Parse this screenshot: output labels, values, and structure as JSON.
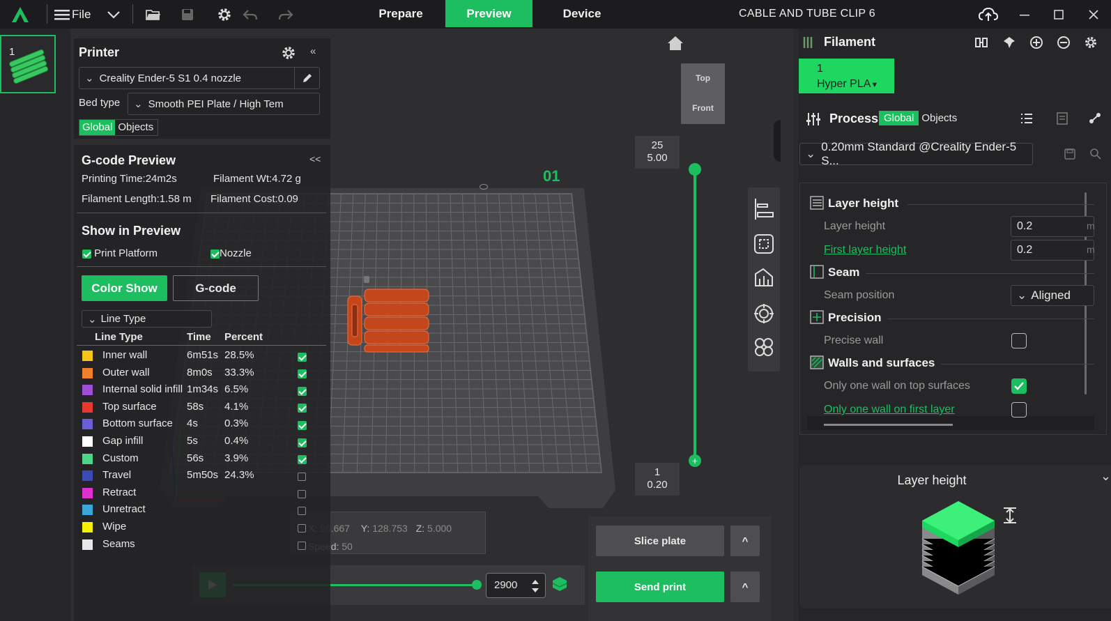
{
  "topbar": {
    "file_label": "File",
    "tabs": [
      "Prepare",
      "Preview",
      "Device"
    ],
    "project_title": "CABLE AND TUBE CLIP 6"
  },
  "plate_thumb": {
    "index": "1"
  },
  "printer": {
    "title": "Printer",
    "printer_name": "Creality Ender-5 S1 0.4 nozzle",
    "bed_type_label": "Bed type",
    "bed_type_value": "Smooth PEI Plate / High Tem",
    "scope_global": "Global",
    "scope_objects": "Objects"
  },
  "gcode": {
    "title": "G-code Preview",
    "collapse": "<<",
    "printing_time": "Printing Time:24m2s",
    "filament_wt": "Filament Wt:4.72 g",
    "filament_length": "Filament Length:1.58 m",
    "filament_cost": "Filament Cost:0.09",
    "show_title": "Show in Preview",
    "print_platform": "Print Platform",
    "nozzle": "Nozzle",
    "color_show_btn": "Color Show",
    "gcode_btn": "G-code",
    "view_select": "Line Type",
    "headers": {
      "type": "Line Type",
      "time": "Time",
      "percent": "Percent"
    },
    "rows": [
      {
        "name": "Inner wall",
        "time": "6m51s",
        "percent": "28.5%",
        "color": "#f5c518",
        "checked": true
      },
      {
        "name": "Outer wall",
        "time": "8m0s",
        "percent": "33.3%",
        "color": "#f07f2e",
        "checked": true
      },
      {
        "name": "Internal solid infill",
        "time": "1m34s",
        "percent": "6.5%",
        "color": "#a04ed6",
        "checked": true
      },
      {
        "name": "Top surface",
        "time": "58s",
        "percent": "4.1%",
        "color": "#e8392d",
        "checked": true
      },
      {
        "name": "Bottom surface",
        "time": "4s",
        "percent": "0.3%",
        "color": "#6b5fd8",
        "checked": true
      },
      {
        "name": "Gap infill",
        "time": "5s",
        "percent": "0.4%",
        "color": "#ffffff",
        "checked": true
      },
      {
        "name": "Custom",
        "time": "56s",
        "percent": "3.9%",
        "color": "#4fd58a",
        "checked": true
      },
      {
        "name": "Travel",
        "time": "5m50s",
        "percent": "24.3%",
        "color": "#3a4bb5",
        "checked": false
      },
      {
        "name": "Retract",
        "time": "",
        "percent": "",
        "color": "#e030d0",
        "checked": false
      },
      {
        "name": "Unretract",
        "time": "",
        "percent": "",
        "color": "#39a8d8",
        "checked": false
      },
      {
        "name": "Wipe",
        "time": "",
        "percent": "",
        "color": "#f5ef00",
        "checked": false
      },
      {
        "name": "Seams",
        "time": "",
        "percent": "",
        "color": "#e8e8e8",
        "checked": false
      }
    ]
  },
  "viewport": {
    "plate_label": "01",
    "view_top": "Top",
    "view_front": "Front",
    "layer_top_index": "25",
    "layer_top_height": "5.00",
    "layer_bottom_index": "1",
    "layer_bottom_height": "0.20",
    "coords": {
      "x_label": "X:",
      "x": "96.667",
      "y_label": "Y:",
      "y": "128.753",
      "z_label": "Z:",
      "z": "5.000",
      "speed_label": "Speed:",
      "speed": "50"
    },
    "move_value": "2900",
    "move_progress": 1.0,
    "layer_slider_progress": 1.0
  },
  "actions": {
    "slice": "Slice plate",
    "send": "Send print",
    "more": "^"
  },
  "filament": {
    "title": "Filament",
    "slot_number": "1",
    "slot_name": "Hyper PLA",
    "slot_color": "#1ed760"
  },
  "process": {
    "title": "Process",
    "scope_global": "Global",
    "scope_objects": "Objects",
    "preset": "0.20mm Standard @Creality Ender-5 S...",
    "sections": {
      "layer_height": "Layer height",
      "seam": "Seam",
      "precision": "Precision",
      "walls": "Walls and surfaces"
    },
    "layer_height_label": "Layer height",
    "layer_height_value": "0.2",
    "first_layer_label": "First layer height",
    "first_layer_value": "0.2",
    "unit": "m",
    "seam_pos_label": "Seam position",
    "seam_pos_value": "Aligned",
    "precise_wall_label": "Precise wall",
    "one_wall_top_label": "Only one wall on top surfaces",
    "one_wall_first_label": "Only one wall on first layer"
  },
  "help_card": {
    "title": "Layer height",
    "chevron": "⌄"
  }
}
